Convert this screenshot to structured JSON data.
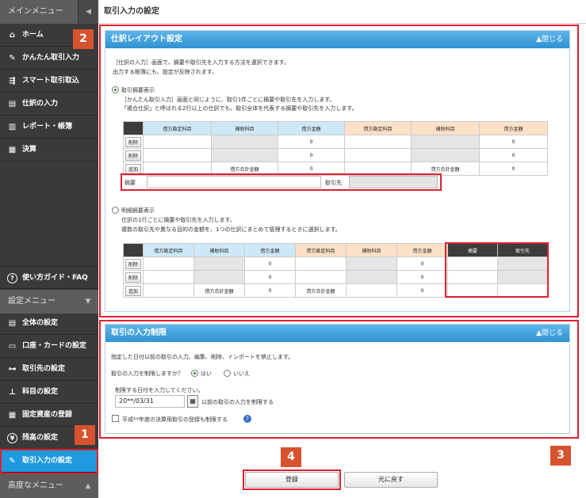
{
  "sidebar": {
    "main_menu_title": "メインメニュー",
    "items": [
      {
        "label": "ホーム",
        "icon": "home-icon",
        "glyph": "⌂"
      },
      {
        "label": "かんたん取引入力",
        "icon": "pencil-icon",
        "glyph": "✎"
      },
      {
        "label": "スマート取引取込",
        "icon": "import-icon",
        "glyph": "⇶"
      },
      {
        "label": "仕訳の入力",
        "icon": "journal-icon",
        "glyph": "▤"
      },
      {
        "label": "レポート・帳簿",
        "icon": "chart-icon",
        "glyph": "▥"
      },
      {
        "label": "決算",
        "icon": "ledger-icon",
        "glyph": "▦"
      }
    ],
    "guide": {
      "label": "使い方ガイド・FAQ",
      "icon": "help-icon",
      "glyph": "?"
    },
    "settings_menu_title": "設定メニュー",
    "settings_items": [
      {
        "label": "全体の設定",
        "icon": "settings-doc-icon",
        "glyph": "▤"
      },
      {
        "label": "口座・カードの設定",
        "icon": "card-icon",
        "glyph": "▭"
      },
      {
        "label": "取引先の設定",
        "icon": "partner-icon",
        "glyph": "⊶"
      },
      {
        "label": "科目の設定",
        "icon": "tree-icon",
        "glyph": "⊥"
      },
      {
        "label": "固定資産の登録",
        "icon": "building-icon",
        "glyph": "▦"
      },
      {
        "label": "残高の設定",
        "icon": "yen-icon",
        "glyph": "¥"
      },
      {
        "label": "取引入力の設定",
        "icon": "gear-pen-icon",
        "glyph": "✎"
      }
    ],
    "advanced_menu_title": "高度なメニュー"
  },
  "header": {
    "title": "取引入力の設定"
  },
  "layout_panel": {
    "title": "仕訳レイアウト設定",
    "close_label": "▲閉じる",
    "desc1": "［仕訳の入力］画面で、摘要や取引先を入力する方法を選択できます。",
    "desc2": "出力する帳簿にも、設定が反映されます。",
    "option1": {
      "label": "取引摘要表示",
      "desc1": "［かんたん取引入力］画面と同じように、取引1件ごとに摘要や取引先を入力します。",
      "desc2": "「複合仕訳」と呼ばれる2行以上の仕訳でも、取引全体を代表する摘要や取引先を入力します。"
    },
    "option2": {
      "label": "明細摘要表示",
      "desc1": "仕訳の1行ごとに摘要や取引先を入力します。",
      "desc2": "複数の取引先や異なる目的の金額を、1つの仕訳にまとめて管理するときに選択します。"
    },
    "table": {
      "debit_account": "借方勘定科目",
      "sub_account": "補助科目",
      "debit_amount": "借方金額",
      "credit_account": "貸方勘定科目",
      "credit_amount": "貸方金額",
      "delete_label": "削除",
      "add_label": "追加",
      "debit_total": "借方合計金額",
      "credit_total": "貸方合計金額",
      "zero": "0",
      "memo": "摘要",
      "partner": "取引先"
    }
  },
  "restrict_panel": {
    "title": "取引の入力制限",
    "close_label": "▲閉じる",
    "desc": "指定した日付以前の取引の入力、編集、削除、インポートを禁止します。",
    "question": "取引の入力を制限しますか？",
    "yes": "はい",
    "no": "いいえ",
    "date_prompt": "制限する日付を入力してください。",
    "date_value": "20**/03/31",
    "date_suffix": "以前の取引の入力を制限する",
    "checkbox_label": "平成**年度の決算用取引の登録も制限する"
  },
  "footer": {
    "register_label": "登録",
    "reset_label": "元に戻す"
  },
  "annotations": {
    "b1": "1",
    "b2": "2",
    "b3": "3",
    "b4": "4"
  },
  "colors": {
    "accent": "#1e9be0",
    "callout_red": "#e0202f",
    "badge": "#d7522e",
    "sidebar_bg": "#3a3a3a"
  }
}
